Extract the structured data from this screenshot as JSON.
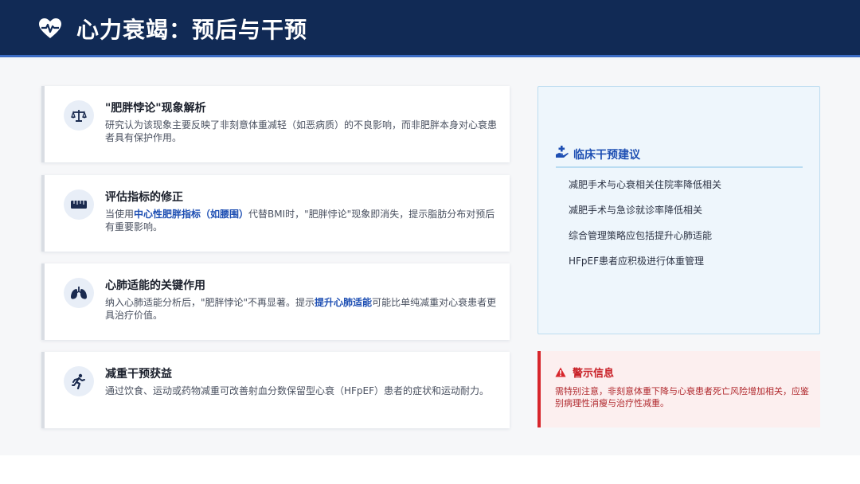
{
  "header": {
    "title": "心力衰竭：预后与干预",
    "icon": "heart-pulse-icon"
  },
  "cards": [
    {
      "icon": "balance-scale-icon",
      "title": "\"肥胖悖论\"现象解析",
      "text": "研究认为该现象主要反映了非刻意体重减轻（如恶病质）的不良影响，而非肥胖本身对心衰患者具有保护作用。"
    },
    {
      "icon": "ruler-icon",
      "title": "评估指标的修正",
      "text_before": "当使用",
      "text_highlight": "中心性肥胖指标（如腰围）",
      "text_after": "代替BMI时，\"肥胖悖论\"现象即消失，提示脂肪分布对预后有重要影响。"
    },
    {
      "icon": "lungs-icon",
      "title": "心肺适能的关键作用",
      "text_before": "纳入心肺适能分析后，\"肥胖悖论\"不再显著。提示",
      "text_highlight": "提升心肺适能",
      "text_after": "可能比单纯减重对心衰患者更具治疗价值。"
    },
    {
      "icon": "running-icon",
      "title": "减重干预获益",
      "text": "通过饮食、运动或药物减重可改善射血分数保留型心衰（HFpEF）患者的症状和运动耐力。"
    }
  ],
  "recommendations": {
    "icon": "hand-medical-icon",
    "title": "临床干预建议",
    "items": [
      "减肥手术与心衰相关住院率降低相关",
      "减肥手术与急诊就诊率降低相关",
      "综合管理策略应包括提升心肺适能",
      "HFpEF患者应积极进行体重管理"
    ]
  },
  "warning": {
    "icon": "warning-triangle-icon",
    "title": "警示信息",
    "text": "需特别注意，非刻意体重下降与心衰患者死亡风险增加相关，应鉴别病理性消瘦与治疗性减重。"
  },
  "colors": {
    "header_bg": "#112a55",
    "accent_blue": "#1e4fb3",
    "warning_red": "#d7262c"
  }
}
